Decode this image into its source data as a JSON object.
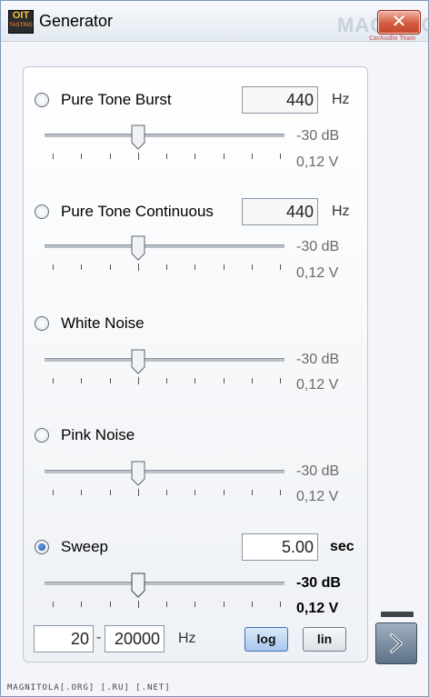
{
  "window": {
    "title": "Generator",
    "icon_text_1": "OIT",
    "icon_text_2": "TASTING",
    "close_symbol": "✕"
  },
  "watermark": {
    "text": "MAGNITOLA",
    "sub": "CarAudio Team"
  },
  "sections": [
    {
      "label": "Pure Tone Burst",
      "selected": false,
      "value": "440",
      "unit": "Hz",
      "level_db": "-30 dB",
      "level_v": "0,12 V"
    },
    {
      "label": "Pure Tone Continuous",
      "selected": false,
      "value": "440",
      "unit": "Hz",
      "level_db": "-30 dB",
      "level_v": "0,12 V"
    },
    {
      "label": "White Noise",
      "selected": false,
      "level_db": "-30 dB",
      "level_v": "0,12 V"
    },
    {
      "label": "Pink Noise",
      "selected": false,
      "level_db": "-30 dB",
      "level_v": "0,12 V"
    },
    {
      "label": "Sweep",
      "selected": true,
      "value": "5.00",
      "unit": "sec",
      "level_db": "-30 dB",
      "level_v": "0,12 V"
    }
  ],
  "sweep_range": {
    "from": "20",
    "separator": "-",
    "to": "20000",
    "unit": "Hz",
    "log_label": "log",
    "lin_label": "lin",
    "scale_selected": "log"
  },
  "footer": {
    "text": "MAGNITOLA[.ORG] [.RU] [.NET]"
  },
  "icons": {
    "next": "chevron-right-icon",
    "close": "close-icon",
    "app": "app-icon"
  },
  "colors": {
    "title_bar": "#e3e9f1",
    "close_button": "#c7452b",
    "selected_radio": "#1d4fa0",
    "log_button": "#a9c6ec"
  }
}
